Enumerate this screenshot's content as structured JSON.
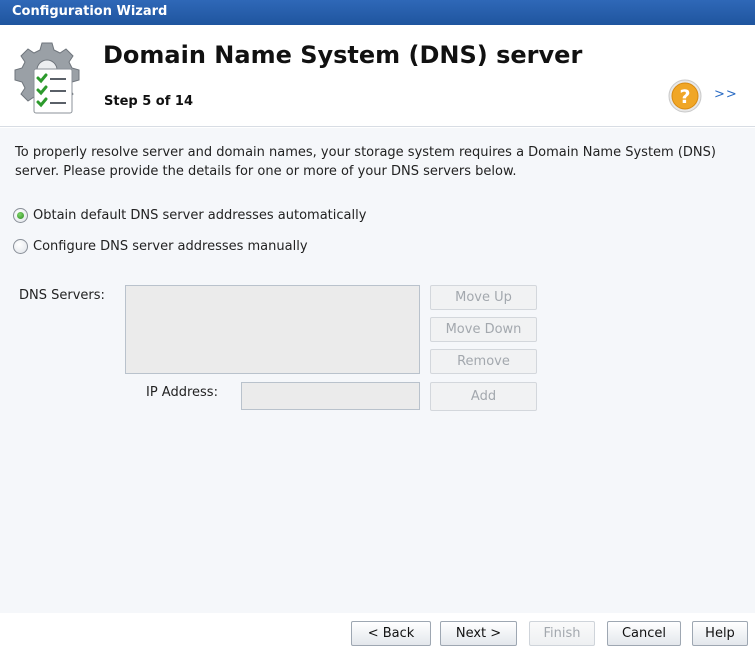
{
  "window": {
    "title": "Configuration Wizard"
  },
  "header": {
    "title": "Domain Name System (DNS) server",
    "step": "Step 5 of 14",
    "more_link": ">>"
  },
  "content": {
    "intro": "To properly resolve server and domain names, your storage system requires a Domain Name System (DNS) server. Please provide the details for one or more of your DNS servers below.",
    "radio_auto": {
      "label": "Obtain default DNS server addresses automatically",
      "checked": true
    },
    "radio_manual": {
      "label": "Configure DNS server addresses manually",
      "checked": false
    },
    "dns_servers_label": "DNS Servers:",
    "ip_address_label": "IP Address:",
    "ip_address_value": "",
    "buttons": {
      "move_up": "Move Up",
      "move_down": "Move Down",
      "remove": "Remove",
      "add": "Add"
    }
  },
  "footer": {
    "back": "< Back",
    "next": "Next >",
    "finish": "Finish",
    "cancel": "Cancel",
    "help": "Help"
  },
  "colors": {
    "titlebar": "#2f68b8",
    "accent_link": "#2b6cc4",
    "radio_selected": "#2a8a1e",
    "help_icon": "#f0a626"
  },
  "icons": {
    "wizard": "gear-checklist-icon",
    "help": "question-mark-icon"
  }
}
